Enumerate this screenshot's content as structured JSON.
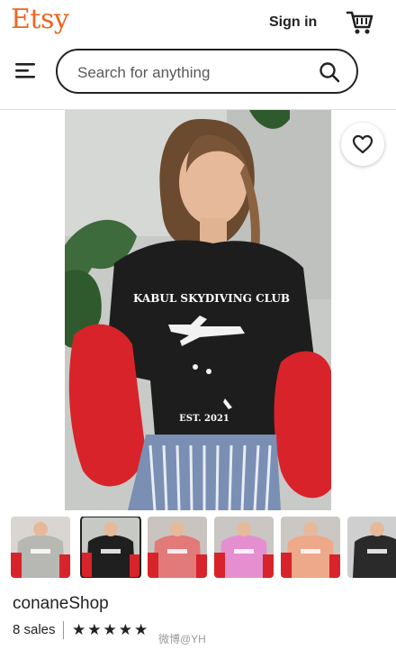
{
  "header": {
    "logo": "Etsy",
    "sign_in": "Sign in",
    "search_placeholder": "Search for anything"
  },
  "product": {
    "shirt_text_top": "KABUL SKYDIVING CLUB",
    "shirt_text_bottom": "EST. 2021"
  },
  "thumbnails": [
    {
      "shirt_color": "#b7b7b3",
      "bg": "#d9d6d2"
    },
    {
      "shirt_color": "#1f1f1f",
      "bg": "#c7c9c5",
      "selected": true
    },
    {
      "shirt_color": "#e27a79",
      "bg": "#c9c4c0"
    },
    {
      "shirt_color": "#e58fd0",
      "bg": "#c9c6c3"
    },
    {
      "shirt_color": "#eea88a",
      "bg": "#cbc7c2"
    },
    {
      "shirt_color": "#2a2a2a",
      "bg": "#cfcfcf"
    }
  ],
  "shop": {
    "name": "conaneShop",
    "sales": "8 sales",
    "stars": "★★★★★",
    "rating": 5
  },
  "watermark": "微博@YH",
  "colors": {
    "accent": "#f1641e",
    "text": "#222222"
  }
}
